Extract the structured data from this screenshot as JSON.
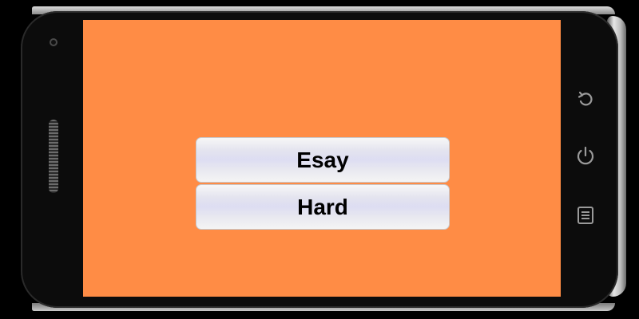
{
  "menu": {
    "buttons": [
      {
        "label": "Esay"
      },
      {
        "label": "Hard"
      }
    ]
  },
  "device": {
    "nav_icons": [
      "back-icon",
      "power-icon",
      "menu-icon"
    ]
  },
  "colors": {
    "screen_background": "#FF8C45",
    "button_text": "#000000",
    "device_frame": "#0c0c0c"
  }
}
